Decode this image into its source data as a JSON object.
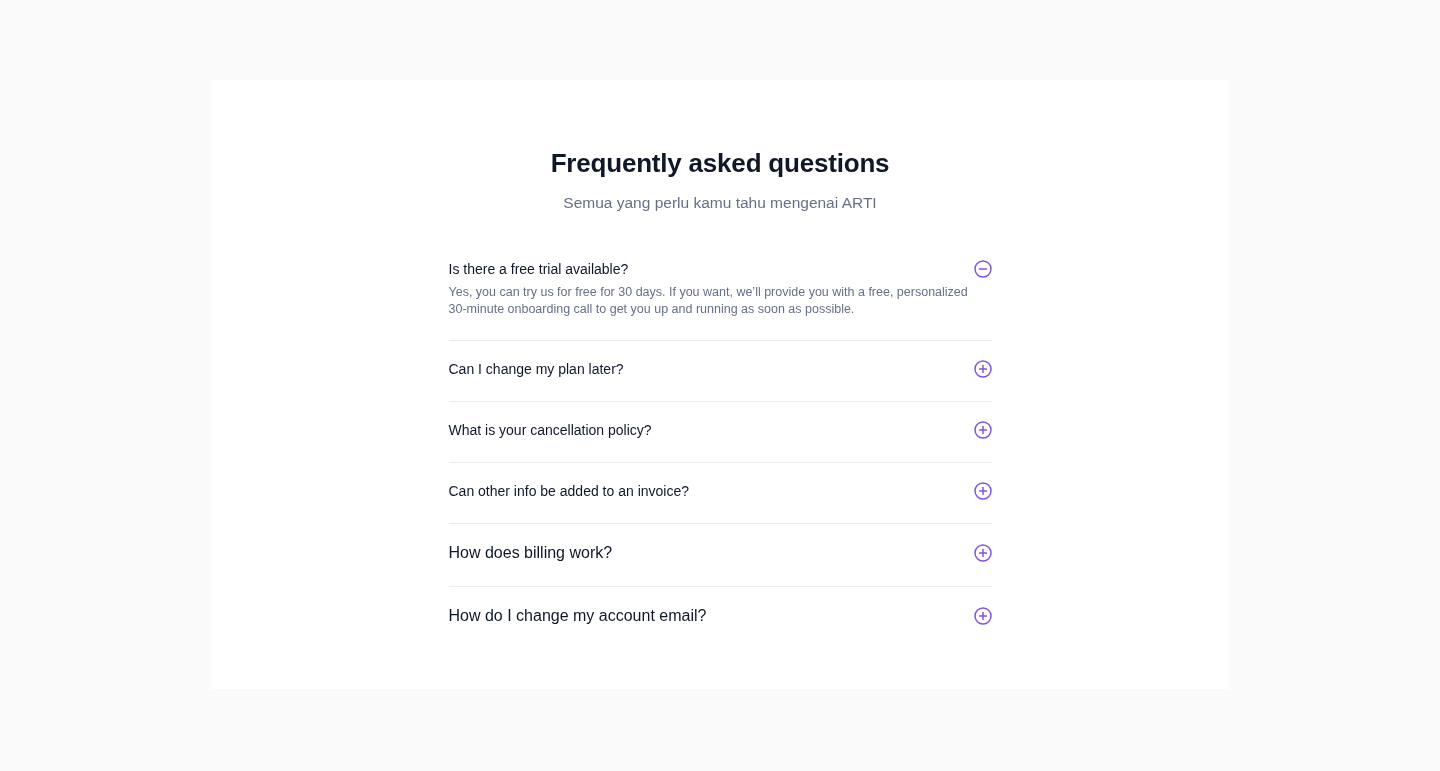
{
  "heading": "Frequently asked questions",
  "subheading": "Semua yang perlu kamu tahu mengenai ARTI",
  "faq": [
    {
      "question": "Is there a free trial available?",
      "expanded": true,
      "answer": "Yes, you can try us for free for 30 days. If you want, we’ll provide you with a free, personalized 30-minute onboarding call to get you up and running as soon as possible."
    },
    {
      "question": "Can I change my plan later?",
      "expanded": false
    },
    {
      "question": "What is your cancellation policy?",
      "expanded": false
    },
    {
      "question": "Can other info be added to an invoice?",
      "expanded": false
    },
    {
      "question": "How does billing work?",
      "expanded": false
    },
    {
      "question": "How do I change my account email?",
      "expanded": false
    }
  ]
}
